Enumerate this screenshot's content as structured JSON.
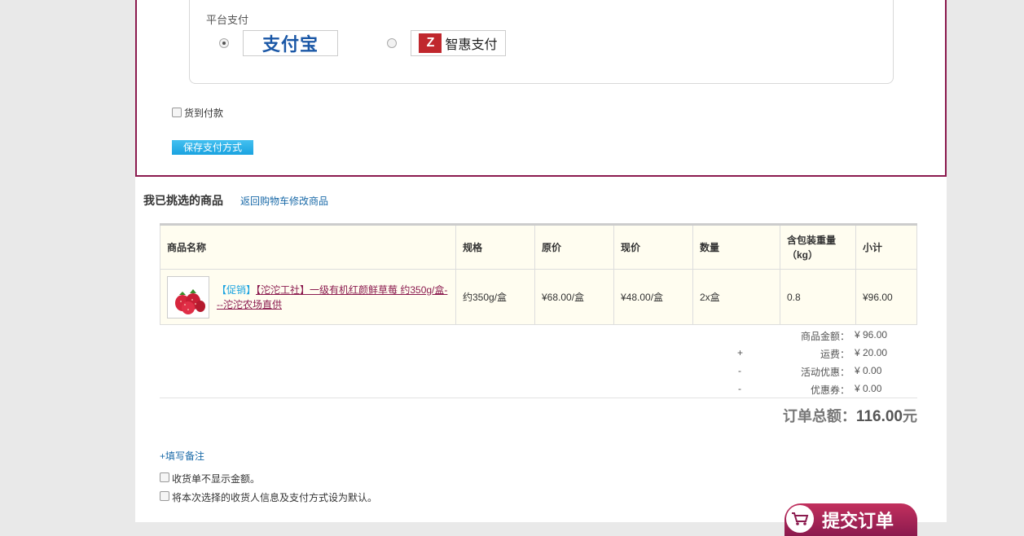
{
  "payment": {
    "platform_title": "平台支付",
    "options": [
      {
        "name": "支付宝",
        "logo_icon": "alipay-logo-icon",
        "selected": true
      },
      {
        "name": "智惠支付",
        "logo_icon": "zhihui-pay-logo-icon",
        "selected": false
      }
    ],
    "cod_label": "货到付款",
    "save_button": "保存支付方式"
  },
  "goods": {
    "section_title": "我已挑选的商品",
    "back_link": "返回购物车修改商品",
    "columns": [
      "商品名称",
      "规格",
      "原价",
      "现价",
      "数量",
      "含包装重量（kg）",
      "小计"
    ],
    "rows": [
      {
        "promo_tag": "【促销】",
        "name": "【沱沱工社】一级有机红颜鲜草莓 约350g/盒---沱沱农场直供",
        "spec": "约350g/盒",
        "original_price": "¥68.00/盒",
        "current_price": "¥48.00/盒",
        "quantity": "2x盒",
        "weight": "0.8",
        "subtotal": "¥96.00"
      }
    ]
  },
  "summary": {
    "goods_amount_label": "商品金额：",
    "goods_amount": "¥ 96.00",
    "shipping_sign": "+",
    "shipping_label": "运费：",
    "shipping": "¥ 20.00",
    "activity_sign": "-",
    "activity_label": "活动优惠：",
    "activity": "¥ 0.00",
    "coupon_sign": "-",
    "coupon_label": "优惠券：",
    "coupon": "¥ 0.00",
    "total_label": "订单总额：",
    "total_value": "116.00",
    "total_unit": "元"
  },
  "options": {
    "remark_link": "+填写备注",
    "hide_amount_label": "收货单不显示金额。",
    "set_default_label": "将本次选择的收货人信息及支付方式设为默认。"
  },
  "submit": {
    "label": "提交订单"
  },
  "colors": {
    "brand": "#8b1a4e",
    "button_blue": "#1aa3e0",
    "link": "#1a6aa8"
  }
}
